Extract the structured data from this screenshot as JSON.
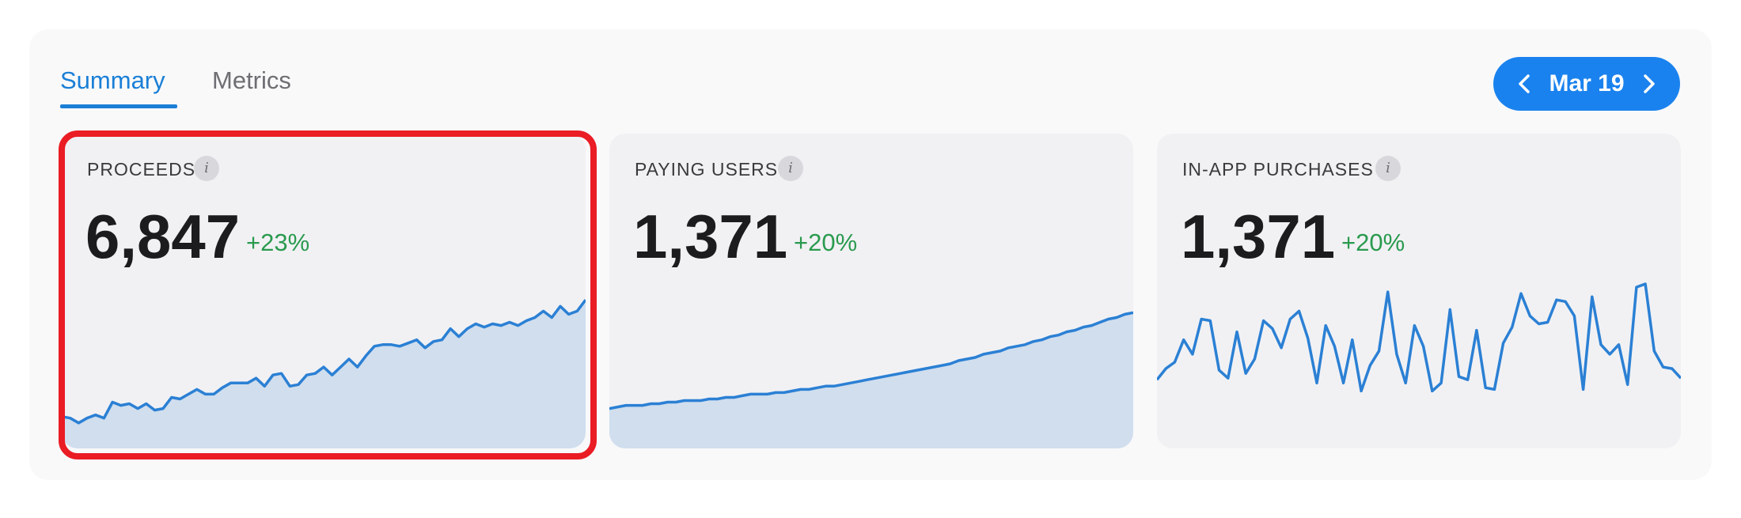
{
  "tabs": [
    {
      "label": "Summary",
      "active": true
    },
    {
      "label": "Metrics",
      "active": false
    }
  ],
  "date_nav": {
    "label": "Mar 19",
    "prev_icon": "chevron-left-icon",
    "next_icon": "chevron-right-icon"
  },
  "colors": {
    "accent": "#1a82ee",
    "positive": "#2a9a4e",
    "line": "#2b80d4",
    "fill": "#d0deee",
    "highlight": "#ea1c24"
  },
  "cards": [
    {
      "title": "PROCEEDS",
      "value": "6,847",
      "change": "+23%",
      "highlighted": true,
      "fill": true,
      "series": [
        15,
        14,
        11,
        14,
        16,
        14,
        24,
        22,
        23,
        20,
        23,
        19,
        20,
        27,
        26,
        29,
        32,
        29,
        29,
        33,
        36,
        36,
        36,
        39,
        34,
        41,
        42,
        34,
        35,
        41,
        42,
        46,
        41,
        46,
        51,
        46,
        53,
        59,
        60,
        60,
        59,
        61,
        63,
        58,
        62,
        63,
        70,
        65,
        70,
        73,
        71,
        73,
        72,
        74,
        72,
        75,
        77,
        81,
        77,
        84,
        79,
        81,
        88
      ]
    },
    {
      "title": "PAYING USERS",
      "value": "1,371",
      "change": "+20%",
      "highlighted": false,
      "fill": true,
      "series": [
        20,
        21,
        22,
        22,
        22,
        23,
        23,
        24,
        24,
        25,
        25,
        25,
        26,
        26,
        27,
        27,
        28,
        29,
        29,
        29,
        30,
        30,
        31,
        32,
        32,
        33,
        34,
        34,
        35,
        36,
        37,
        38,
        39,
        40,
        41,
        42,
        43,
        44,
        45,
        46,
        47,
        48,
        50,
        51,
        52,
        54,
        55,
        56,
        58,
        59,
        60,
        62,
        63,
        65,
        66,
        68,
        69,
        71,
        72,
        74,
        76,
        77,
        79,
        80
      ]
    },
    {
      "title": "IN-APP PURCHASES",
      "value": "1,371",
      "change": "+20%",
      "highlighted": false,
      "fill": false,
      "series": [
        38,
        45,
        49,
        63,
        54,
        76,
        75,
        44,
        39,
        68,
        42,
        51,
        75,
        70,
        58,
        76,
        81,
        64,
        36,
        72,
        59,
        36,
        63,
        31,
        47,
        56,
        93,
        54,
        36,
        72,
        59,
        31,
        36,
        82,
        40,
        38,
        69,
        33,
        32,
        61,
        71,
        92,
        78,
        73,
        74,
        88,
        87,
        78,
        32,
        90,
        60,
        54,
        60,
        35,
        96,
        98,
        56,
        46,
        45,
        39
      ]
    }
  ]
}
